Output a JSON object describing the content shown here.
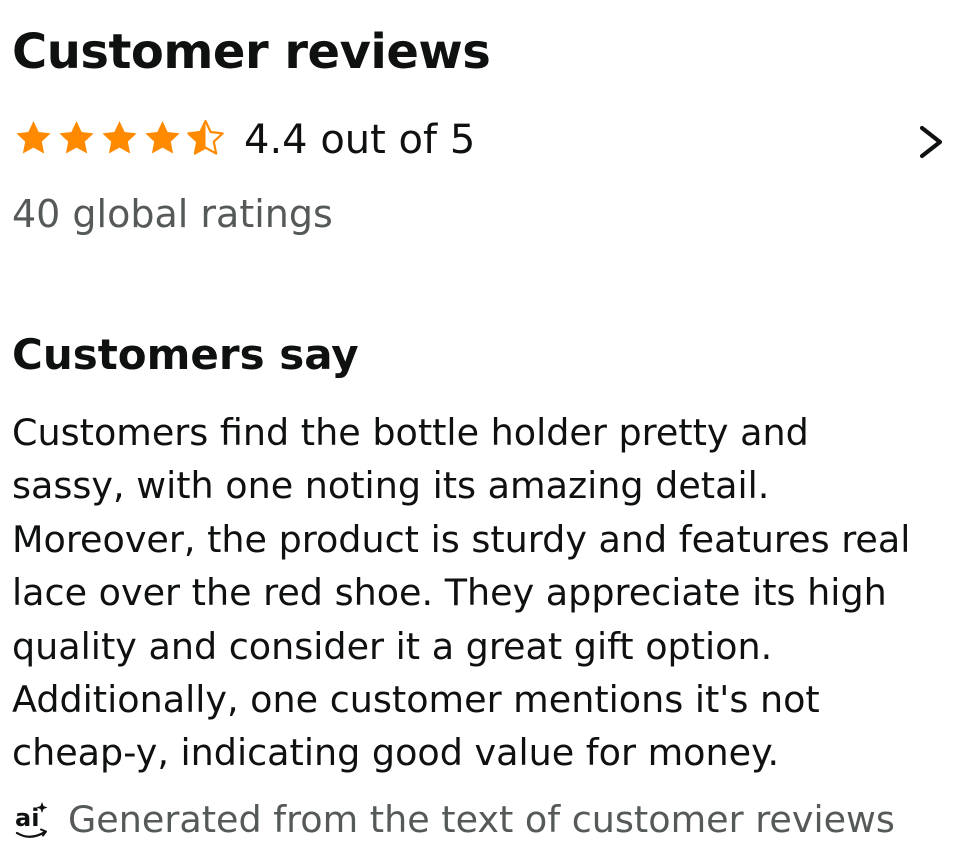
{
  "reviews": {
    "title": "Customer reviews",
    "rating_text": "4.4 out of 5",
    "rating_value": 4.4,
    "rating_max": 5,
    "global_ratings": "40 global ratings",
    "star_color": "#ff8a00",
    "chevron_icon": "chevron-right-icon"
  },
  "customers_say": {
    "heading": "Customers say",
    "summary_lines": [
      "Customers find the bottle holder pretty and",
      "sassy, with one noting its amazing detail.",
      "Moreover, the product is sturdy and features real",
      "lace over the red shoe. They appreciate its high",
      "quality and consider it a great gift option.",
      "Additionally, one customer mentions it's not",
      "cheap-y, indicating good value for money."
    ],
    "ai_icon": "ai-sparkle-icon",
    "ai_note": "Generated from the text of customer reviews"
  }
}
